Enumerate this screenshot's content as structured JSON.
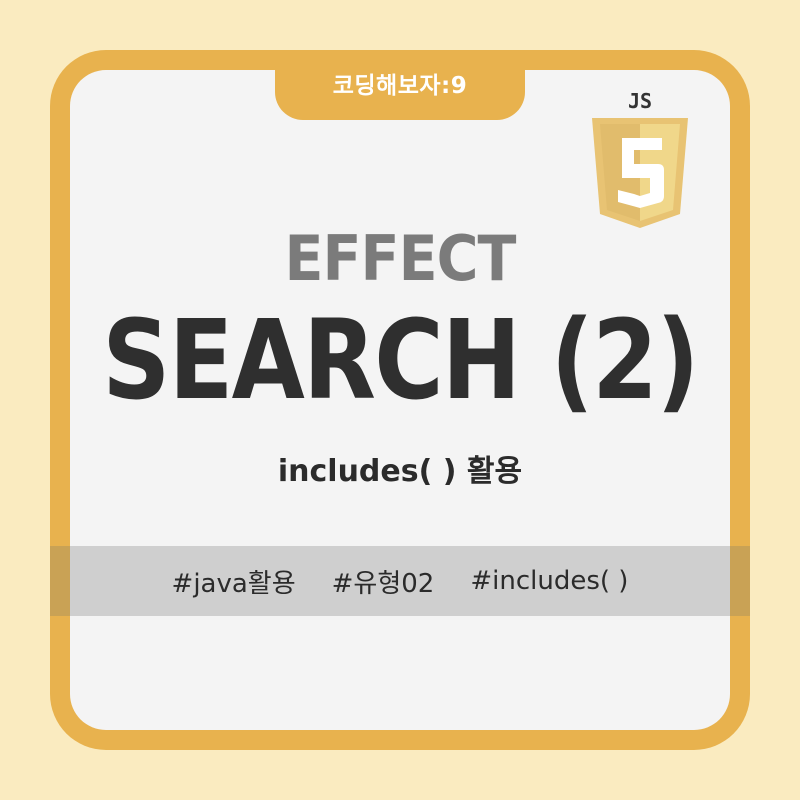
{
  "badge": {
    "label": "코딩해보자:9"
  },
  "logo": {
    "text": "JS",
    "number": "5"
  },
  "heading": {
    "overline": "EFFECT",
    "title": "SEARCH (2)",
    "subtitle": "includes( ) 활용"
  },
  "tags": [
    "#java활용",
    "#유형02",
    "#includes( )"
  ],
  "colors": {
    "background": "#faebc0",
    "frame": "#e8b24e",
    "card": "#f4f4f4",
    "band": "#cfcfcf",
    "text_dark": "#2f2f2f",
    "text_gray": "#7b7b7b"
  }
}
